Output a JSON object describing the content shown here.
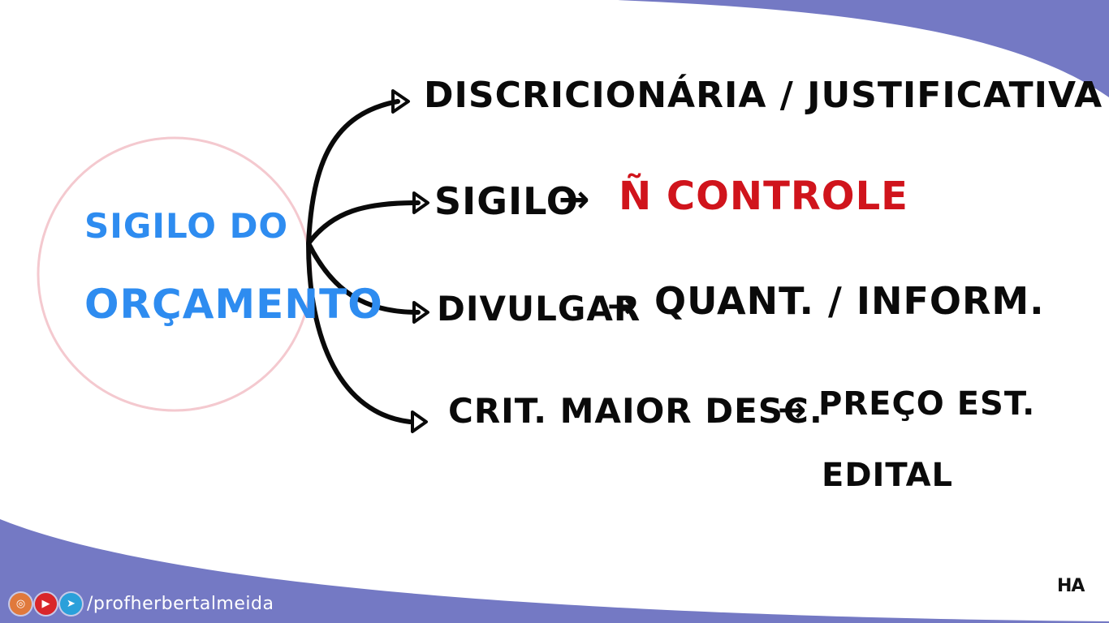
{
  "center": {
    "line1": "Sigilo do",
    "line2": "Orçamento"
  },
  "branches": {
    "b1": {
      "text": "Discricionária / Justificativa"
    },
    "b2": {
      "text": "Sigilo",
      "arrow": "→",
      "result": "Ñ Controle"
    },
    "b3": {
      "text": "Divulgar",
      "arrow": "→",
      "result": "Quant. / Inform."
    },
    "b4": {
      "text": "Crit. Maior Desc.",
      "arrow": "→",
      "result_line1": "Preço Est.",
      "result_line2": "Edital"
    }
  },
  "footer": {
    "icons": [
      "instagram-icon",
      "youtube-icon",
      "telegram-icon"
    ],
    "handle": "/profherbertalmeida"
  },
  "logo": "HA",
  "colors": {
    "ink": "#0a0a0a",
    "red": "#d0141c",
    "blue": "#2e8cf0",
    "band": "#7479c4",
    "circle": "#f4c9cf"
  }
}
